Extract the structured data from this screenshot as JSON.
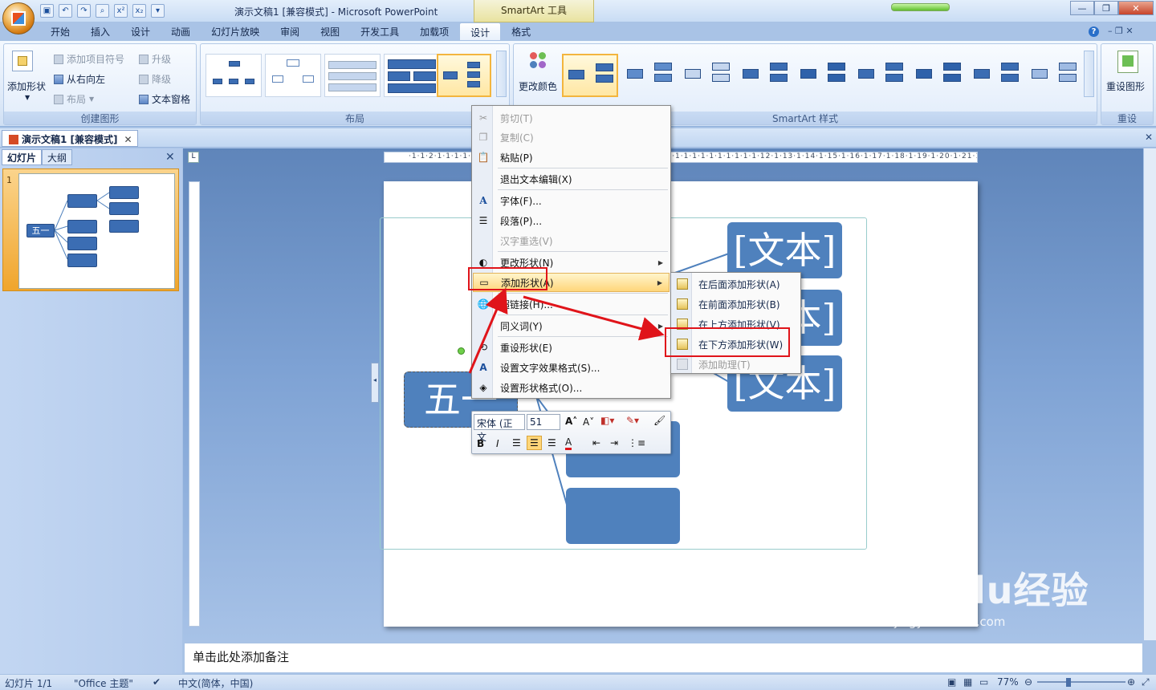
{
  "window": {
    "title": "演示文稿1 [兼容模式] - Microsoft PowerPoint",
    "tool_tab": "SmartArt 工具"
  },
  "ribbon_tabs": [
    "开始",
    "插入",
    "设计",
    "动画",
    "幻灯片放映",
    "审阅",
    "视图",
    "开发工具",
    "加载项",
    "设计",
    "格式"
  ],
  "active_tab_index": 9,
  "groups": {
    "create": {
      "label": "创建图形",
      "add_shape": "添加形状",
      "add_bullet": "添加项目符号",
      "right_to_left": "从右向左",
      "layout": "布局",
      "promote": "升级",
      "demote": "降级",
      "text_pane": "文本窗格"
    },
    "layouts": {
      "label": "布局"
    },
    "styles": {
      "label": "SmartArt 样式",
      "change_colors": "更改颜色"
    },
    "reset": {
      "label": "重设",
      "reset_graphic": "重设图形"
    }
  },
  "document_tab": "演示文稿1 [兼容模式]",
  "left_panel": {
    "tabs": [
      "幻灯片",
      "大纲"
    ],
    "slide_number": "1",
    "thumb_label": "五一"
  },
  "ruler_text": "·1·1·2·1·1·1·1·1·1·1·1·1·1·1·1·1·1·1·1·1·1·1·1·1·1·1·1·1·1·1·1·1·1·1·1·1·1·1·1·1·1·12·1·13·1·14·1·15·1·16·1·17·1·18·1·19·1·20·1·21·1·22·1·23·1·24·1",
  "smartart": {
    "root_text": "五一",
    "child_text": "[文本]"
  },
  "context_menu": {
    "items": [
      {
        "label": "剪切(T)",
        "icon": "scissors-icon",
        "disabled": true
      },
      {
        "label": "复制(C)",
        "icon": "copy-icon",
        "disabled": true
      },
      {
        "label": "粘贴(P)",
        "icon": "paste-icon",
        "disabled": false
      },
      {
        "label": "退出文本编辑(X)",
        "icon": "",
        "disabled": false
      },
      {
        "label": "字体(F)...",
        "icon": "font-icon",
        "disabled": false
      },
      {
        "label": "段落(P)...",
        "icon": "paragraph-icon",
        "disabled": false
      },
      {
        "label": "汉字重选(V)",
        "icon": "",
        "disabled": true
      },
      {
        "label": "更改形状(N)",
        "icon": "change-shape-icon",
        "disabled": false
      },
      {
        "label": "添加形状(A)",
        "icon": "add-shape-icon",
        "disabled": false
      },
      {
        "label": "超链接(H)...",
        "icon": "hyperlink-icon",
        "disabled": false
      },
      {
        "label": "同义词(Y)",
        "icon": "",
        "disabled": false
      },
      {
        "label": "重设形状(E)",
        "icon": "reset-shape-icon",
        "disabled": false
      },
      {
        "label": "设置文字效果格式(S)...",
        "icon": "text-effects-icon",
        "disabled": false
      },
      {
        "label": "设置形状格式(O)...",
        "icon": "format-shape-icon",
        "disabled": false
      }
    ]
  },
  "submenu": {
    "items": [
      {
        "label": "在后面添加形状(A)",
        "disabled": false
      },
      {
        "label": "在前面添加形状(B)",
        "disabled": false
      },
      {
        "label": "在上方添加形状(V)",
        "disabled": false
      },
      {
        "label": "在下方添加形状(W)",
        "disabled": false
      },
      {
        "label": "添加助理(T)",
        "disabled": true
      }
    ]
  },
  "mini_toolbar": {
    "font": "宋体 (正文",
    "size": "51"
  },
  "notes_placeholder": "单击此处添加备注",
  "status": {
    "slide": "幻灯片 1/1",
    "theme": "\"Office 主题\"",
    "language": "中文(简体，中国)",
    "zoom": "77%"
  },
  "watermark": {
    "brand": "Baidu经验",
    "url": "jingyan.baidu.com"
  },
  "colors": {
    "accent": "#4f81bd",
    "highlight": "#ffd67a",
    "annotation": "#e0141a"
  }
}
